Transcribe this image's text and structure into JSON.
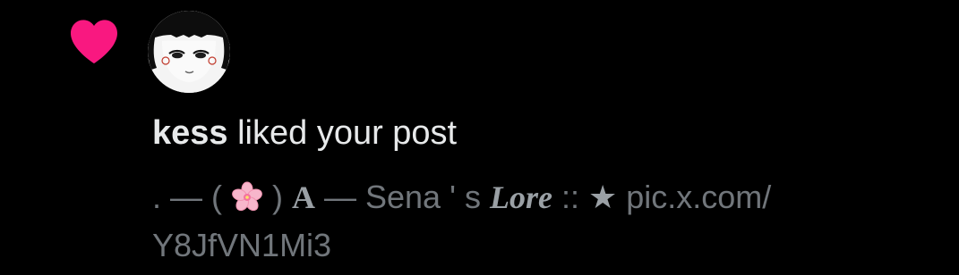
{
  "notification": {
    "type_icon": "heart-icon",
    "icon_color": "#f91880",
    "avatar": "user-avatar",
    "username": "kess",
    "action_text": " liked your post",
    "post": {
      "prefix": ". — ( ",
      "emoji": "cherry-blossom-icon",
      "after_emoji": " ) ",
      "letter_a": "A",
      "dash_name": " — Sena ' s ",
      "lore": "Lore",
      "separator": " :: ",
      "star": "★",
      "link_part1": " pic.x.com/",
      "link_part2": "Y8JfVN1Mi3"
    }
  },
  "colors": {
    "background": "#000000",
    "primary_text": "#e7e9ea",
    "secondary_text": "#71767b",
    "like_pink": "#f91880"
  }
}
